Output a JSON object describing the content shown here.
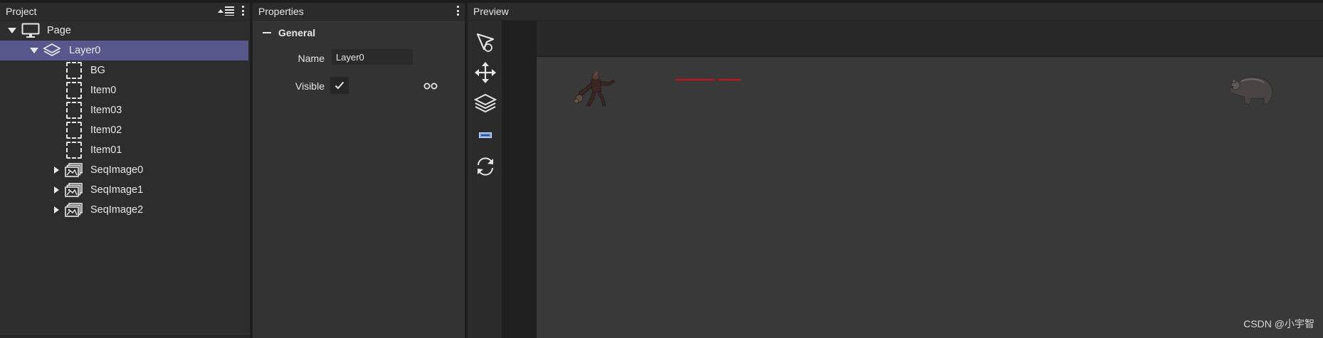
{
  "project": {
    "title": "Project",
    "tree": [
      {
        "label": "Page"
      },
      {
        "label": "Layer0"
      },
      {
        "label": "BG"
      },
      {
        "label": "Item0"
      },
      {
        "label": "Item03"
      },
      {
        "label": "Item02"
      },
      {
        "label": "Item01"
      },
      {
        "label": "SeqImage0"
      },
      {
        "label": "SeqImage1"
      },
      {
        "label": "SeqImage2"
      }
    ]
  },
  "properties": {
    "title": "Properties",
    "section": "General",
    "name_label": "Name",
    "name_value": "Layer0",
    "visible_label": "Visible",
    "visible_checked": true
  },
  "preview": {
    "title": "Preview",
    "tools": [
      "select-icon",
      "move-icon",
      "layers-icon",
      "image-icon",
      "refresh-icon"
    ]
  },
  "watermark": "CSDN @小宇智",
  "colors": {
    "selection": "#57578c",
    "hp_bar": "#cc1010"
  }
}
